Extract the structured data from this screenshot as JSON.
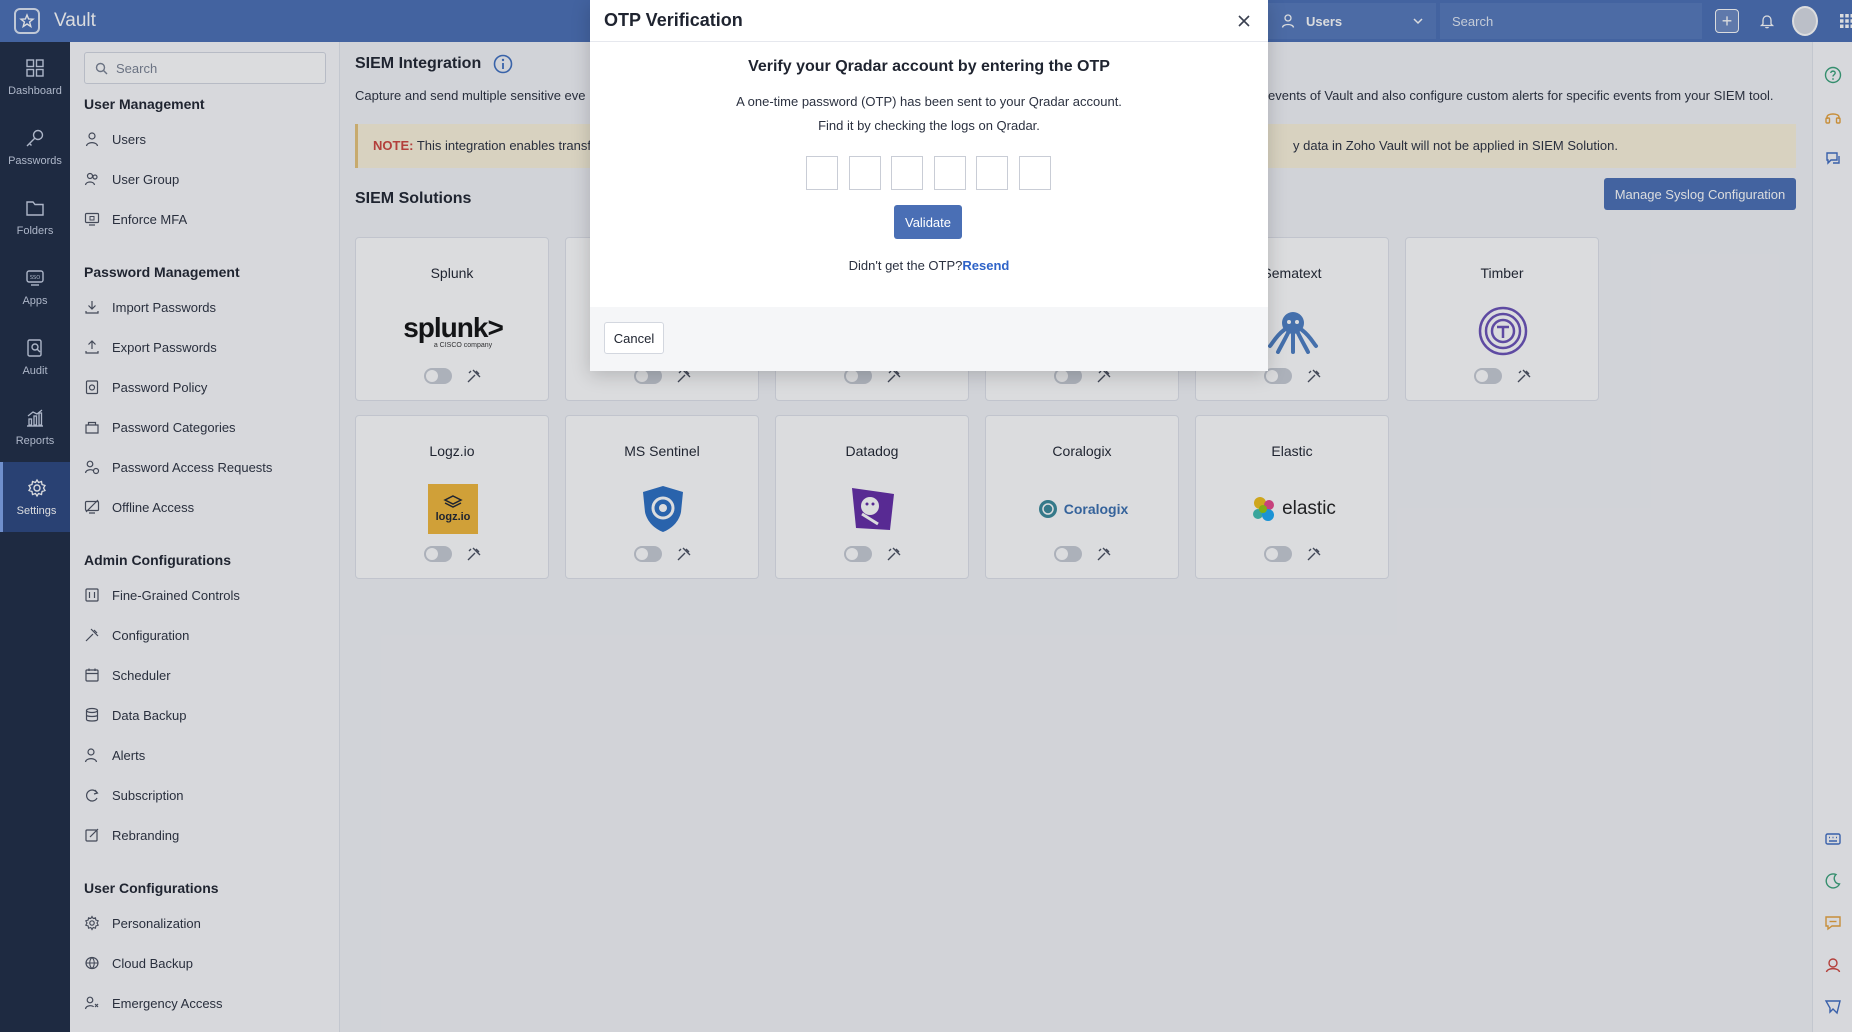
{
  "app": {
    "name": "Vault"
  },
  "topbar": {
    "user_select": "Users",
    "search_placeholder": "Search"
  },
  "rail": [
    {
      "label": "Dashboard",
      "icon": "dashboard-icon"
    },
    {
      "label": "Passwords",
      "icon": "key-icon"
    },
    {
      "label": "Folders",
      "icon": "folder-icon"
    },
    {
      "label": "Apps",
      "icon": "sso-apps-icon"
    },
    {
      "label": "Audit",
      "icon": "audit-icon"
    },
    {
      "label": "Reports",
      "icon": "reports-icon"
    },
    {
      "label": "Settings",
      "icon": "gear-icon",
      "active": true
    }
  ],
  "sidebar": {
    "search_placeholder": "Search",
    "groups": [
      {
        "title": "User Management",
        "items": [
          "Users",
          "User Group",
          "Enforce MFA"
        ]
      },
      {
        "title": "Password Management",
        "items": [
          "Import Passwords",
          "Export Passwords",
          "Password Policy",
          "Password Categories",
          "Password Access Requests",
          "Offline Access"
        ]
      },
      {
        "title": "Admin Configurations",
        "items": [
          "Fine-Grained Controls",
          "Configuration",
          "Scheduler",
          "Data Backup",
          "Alerts",
          "Subscription",
          "Rebranding"
        ]
      },
      {
        "title": "User Configurations",
        "items": [
          "Personalization",
          "Cloud Backup",
          "Emergency Access"
        ]
      }
    ]
  },
  "main": {
    "title": "SIEM Integration",
    "desc_left": "Capture and send multiple sensitive eve",
    "desc_right": "events of Vault and also configure custom alerts for specific events from your SIEM tool.",
    "note_label": "NOTE:",
    "note_left": " This integration enables transf",
    "note_right": "y data in Zoho Vault will not be applied in SIEM Solution.",
    "solutions_title": "SIEM Solutions",
    "manage_button": "Manage Syslog Configuration",
    "cards": [
      {
        "name": "Splunk",
        "logo": "splunk-logo",
        "logo_text": "splunk>",
        "logo_sub": "a CISCO company",
        "enabled": false
      },
      {
        "name": "",
        "logo": "",
        "enabled": false
      },
      {
        "name": "",
        "logo": "",
        "enabled": false
      },
      {
        "name": "",
        "logo": "",
        "enabled": false
      },
      {
        "name": "Sematext",
        "logo": "octopus-logo",
        "enabled": false
      },
      {
        "name": "Timber",
        "logo": "timber-logo",
        "enabled": false
      },
      {
        "name": "Logz.io",
        "logo": "logzio-logo",
        "logo_text": "logz.io",
        "enabled": false
      },
      {
        "name": "MS Sentinel",
        "logo": "sentinel-shield-logo",
        "enabled": false
      },
      {
        "name": "Datadog",
        "logo": "datadog-logo",
        "enabled": false
      },
      {
        "name": "Coralogix",
        "logo": "coralogix-logo",
        "logo_text": "Coralogix",
        "enabled": false
      },
      {
        "name": "Elastic",
        "logo": "elastic-logo",
        "logo_text": "elastic",
        "enabled": false
      }
    ]
  },
  "modal": {
    "title": "OTP Verification",
    "heading": "Verify your Qradar account by entering the OTP",
    "text1": "A one-time password (OTP) has been sent to your Qradar account.",
    "text2": "Find it by checking the logs on Qradar.",
    "otp_digits": [
      "",
      "",
      "",
      "",
      "",
      ""
    ],
    "validate_button": "Validate",
    "resend_prompt": "Didn't get the OTP?",
    "resend_link": "Resend",
    "cancel_button": "Cancel"
  },
  "colors": {
    "topbar": "#4a6fb5",
    "rail": "#1e2b45",
    "primary_button": "#4a6fb5",
    "note_bg": "#fcf3dc",
    "note_label": "#d0453d",
    "link": "#2e63c8"
  }
}
